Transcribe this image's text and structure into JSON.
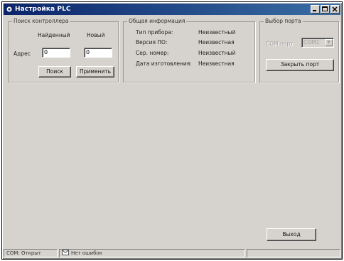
{
  "window": {
    "title": "Настройка PLC"
  },
  "search_group": {
    "legend": "Поиск контроллера",
    "found_label": "Найденный",
    "new_label": "Новый",
    "address_label": "Адрес",
    "found_value": "0",
    "new_value": "0",
    "search_button": "Поиск",
    "apply_button": "Применить"
  },
  "info_group": {
    "legend": "Общая информация",
    "rows": [
      {
        "label": "Тип прибора:",
        "value": "Неизвестный"
      },
      {
        "label": "Версия ПО:",
        "value": "Неизвестная"
      },
      {
        "label": "Сер. номер:",
        "value": "Неизвестный"
      },
      {
        "label": "Дата изготовления:",
        "value": "Неизвестная"
      }
    ]
  },
  "port_group": {
    "legend": "Выбор порта",
    "com_label": "COM порт",
    "com_value": "COM1",
    "close_port_button": "Закрыть порт"
  },
  "exit_button": "Выход",
  "status": {
    "com_status": "COM: Открыт",
    "error_status": "Нет ошибок"
  },
  "icons": {
    "window_icon": "settings-icon",
    "status_icon": "message-icon"
  }
}
